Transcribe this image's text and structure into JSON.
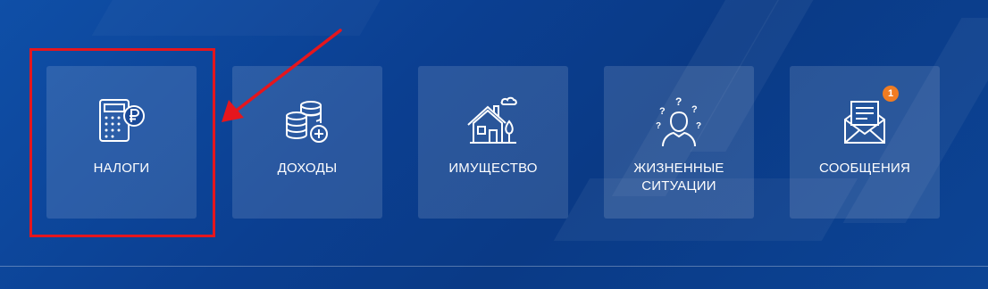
{
  "tiles": [
    {
      "id": "taxes",
      "label": "НАЛОГИ",
      "icon": "calculator-ruble-icon"
    },
    {
      "id": "income",
      "label": "ДОХОДЫ",
      "icon": "coins-plus-icon"
    },
    {
      "id": "property",
      "label": "ИМУЩЕСТВО",
      "icon": "house-icon"
    },
    {
      "id": "life",
      "label": "ЖИЗНЕННЫЕ СИТУАЦИИ",
      "icon": "person-questions-icon"
    },
    {
      "id": "messages",
      "label": "СООБЩЕНИЯ",
      "icon": "envelope-letter-icon",
      "badge": "1"
    }
  ],
  "colors": {
    "background": "#0b3f91",
    "tile": "rgba(255,255,255,0.13)",
    "highlight": "#e5161d",
    "badge": "#f07c22"
  }
}
